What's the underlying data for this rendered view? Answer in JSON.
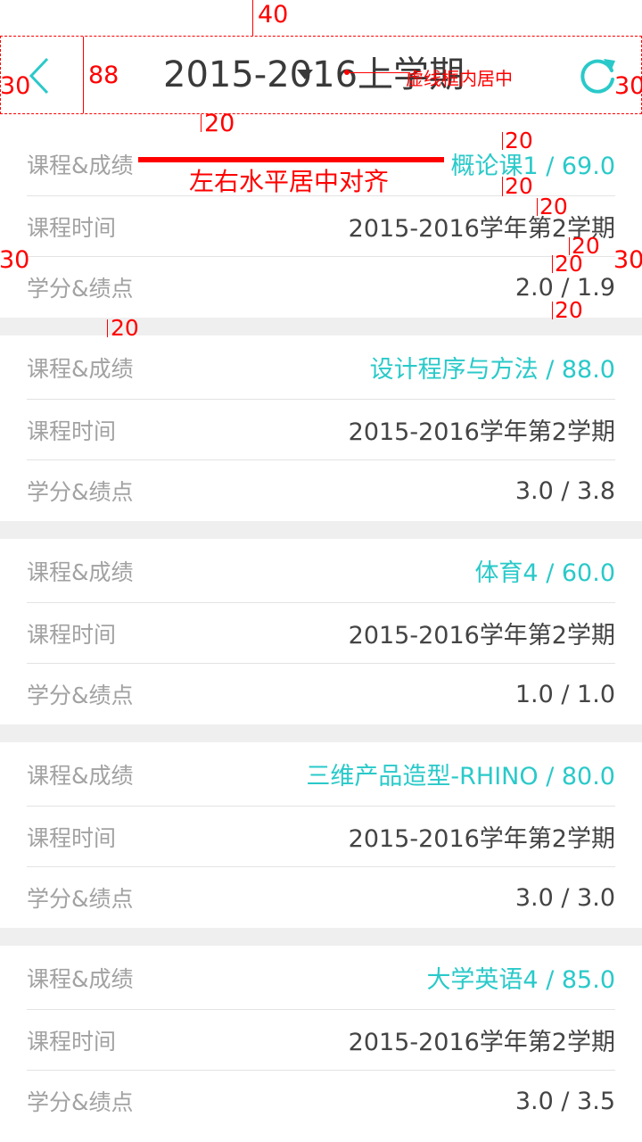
{
  "header": {
    "title": "2015-2016上学期",
    "center_note": "虚线框内居中",
    "accent": "#2ac9c9",
    "back_icon": "chevron-left-icon",
    "refresh_icon": "refresh-icon",
    "dropdown_icon": "caret-down-icon"
  },
  "annotations": {
    "top_margin": "40",
    "header_height": "88",
    "left_margin": "30",
    "right_margin": "30",
    "gap_header": "20",
    "gap_1": "20",
    "gap_2": "20",
    "gap_3": "20",
    "gap_4": "20",
    "gap_5": "20",
    "gap_6": "20",
    "left_margin_row": "30",
    "right_margin_row": "30",
    "section_gap": "20",
    "align_note": "左右水平居中对齐"
  },
  "labels": {
    "course_score": "课程&成绩",
    "course_time": "课程时间",
    "credit_gpa": "学分&绩点"
  },
  "courses": [
    {
      "course": "概论课1 / 69.0",
      "time": "2015-2016学年第2学期",
      "credit": "2.0 / 1.9"
    },
    {
      "course": "设计程序与方法 / 88.0",
      "time": "2015-2016学年第2学期",
      "credit": "3.0 / 3.8"
    },
    {
      "course": "体育4 / 60.0",
      "time": "2015-2016学年第2学期",
      "credit": "1.0 / 1.0"
    },
    {
      "course": "三维产品造型-RHINO / 80.0",
      "time": "2015-2016学年第2学期",
      "credit": "3.0 / 3.0"
    },
    {
      "course": "大学英语4 / 85.0",
      "time": "2015-2016学年第2学期",
      "credit": "3.0 / 3.5"
    }
  ]
}
